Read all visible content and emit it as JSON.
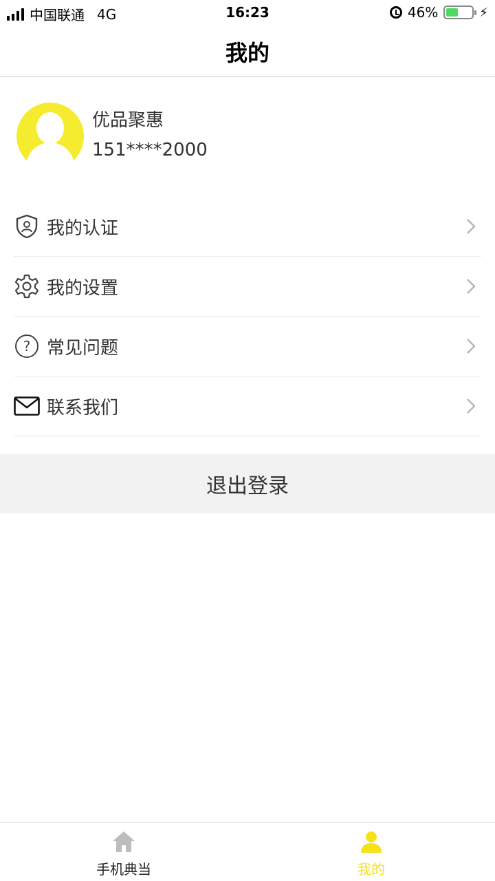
{
  "status_bar": {
    "carrier": "中国联通",
    "network": "4G",
    "time": "16:23",
    "battery": "46%",
    "battery_level": 0.46
  },
  "nav": {
    "title": "我的"
  },
  "profile": {
    "name": "优品聚惠",
    "phone": "151****2000",
    "avatar_color": "#f5ec2f"
  },
  "menu": [
    {
      "label": "我的认证",
      "icon": "shield-user-icon"
    },
    {
      "label": "我的设置",
      "icon": "gear-icon"
    },
    {
      "label": "常见问题",
      "icon": "question-circle-icon"
    },
    {
      "label": "联系我们",
      "icon": "envelope-icon"
    }
  ],
  "logout": {
    "label": "退出登录"
  },
  "tab_bar": {
    "tabs": [
      {
        "label": "手机典当",
        "icon": "home-icon",
        "active": false
      },
      {
        "label": "我的",
        "icon": "person-icon",
        "active": true
      }
    ],
    "active_color": "#f5e21b"
  }
}
